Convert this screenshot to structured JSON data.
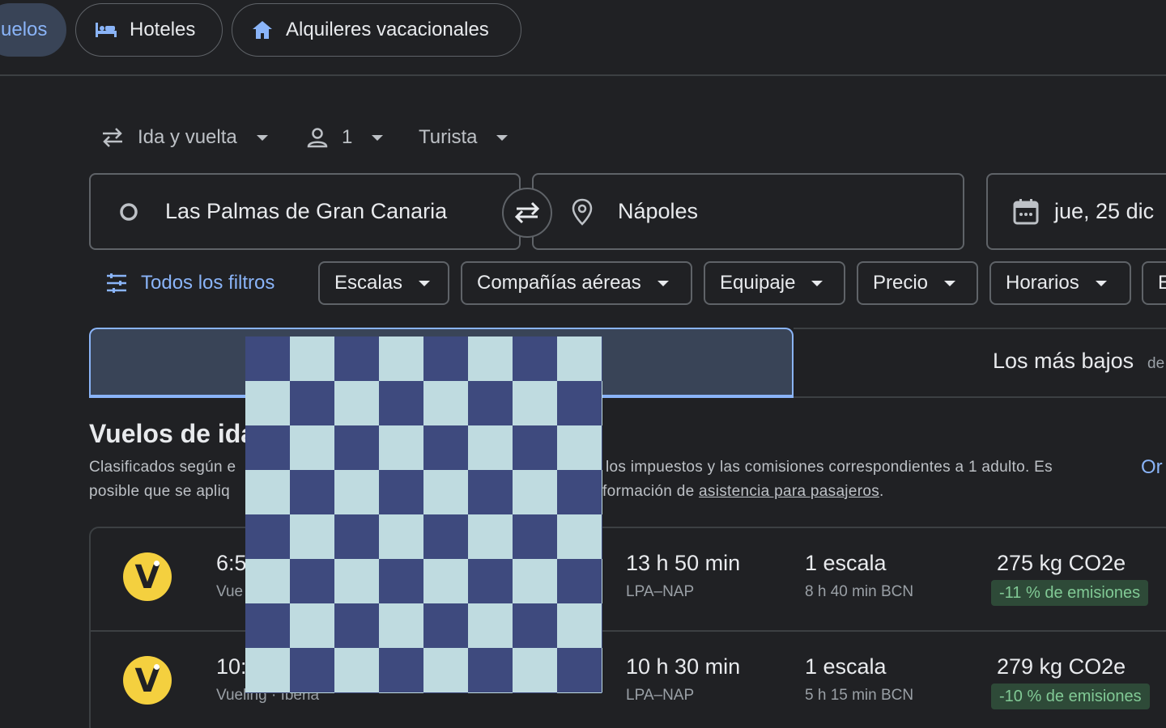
{
  "nav": {
    "tabs": [
      {
        "label": "uelos"
      },
      {
        "label": "Hoteles"
      },
      {
        "label": "Alquileres vacacionales"
      }
    ]
  },
  "trip": {
    "type": "Ida y vuelta",
    "passengers": "1",
    "cabin": "Turista"
  },
  "search": {
    "origin": "Las Palmas de Gran Canaria",
    "destination": "Nápoles",
    "date": "jue, 25 dic"
  },
  "filters": {
    "all": "Todos los filtros",
    "items": [
      "Escalas",
      "Compañías aéreas",
      "Equipaje",
      "Precio",
      "Horarios",
      "E"
    ]
  },
  "sort_tabs": {
    "second_label": "Los más bajos",
    "second_suffix": "de"
  },
  "results": {
    "heading": "Vuelos de ida",
    "subtitle_line1_left": "Clasificados según e",
    "subtitle_line1_right": "los impuestos y las comisiones correspondientes a 1 adulto. Es",
    "subtitle_line2_left": "posible que se apliq",
    "subtitle_line2_mid": "formación de",
    "subtitle_link": "asistencia para pasajeros",
    "subtitle_end": ".",
    "sort_link": "Or",
    "flights": [
      {
        "logo": "V",
        "time": "6:5",
        "airline": "Vue",
        "duration": "13 h 50 min",
        "route": "LPA–NAP",
        "stops": "1 escala",
        "layover": "8 h 40 min BCN",
        "co2": "275 kg CO2e",
        "emissions": "-11 % de emisiones"
      },
      {
        "logo": "V",
        "time": "10:",
        "airline": "Vueling · Iberia",
        "duration": "10 h 30 min",
        "route": "LPA–NAP",
        "stops": "1 escala",
        "layover": "5 h 15 min BCN",
        "co2": "279 kg CO2e",
        "emissions": "-10 % de emisiones"
      }
    ]
  },
  "colors": {
    "accent": "#8ab4f8",
    "background": "#202124",
    "logo": "#f4d03f",
    "emission_text": "#81c995"
  }
}
